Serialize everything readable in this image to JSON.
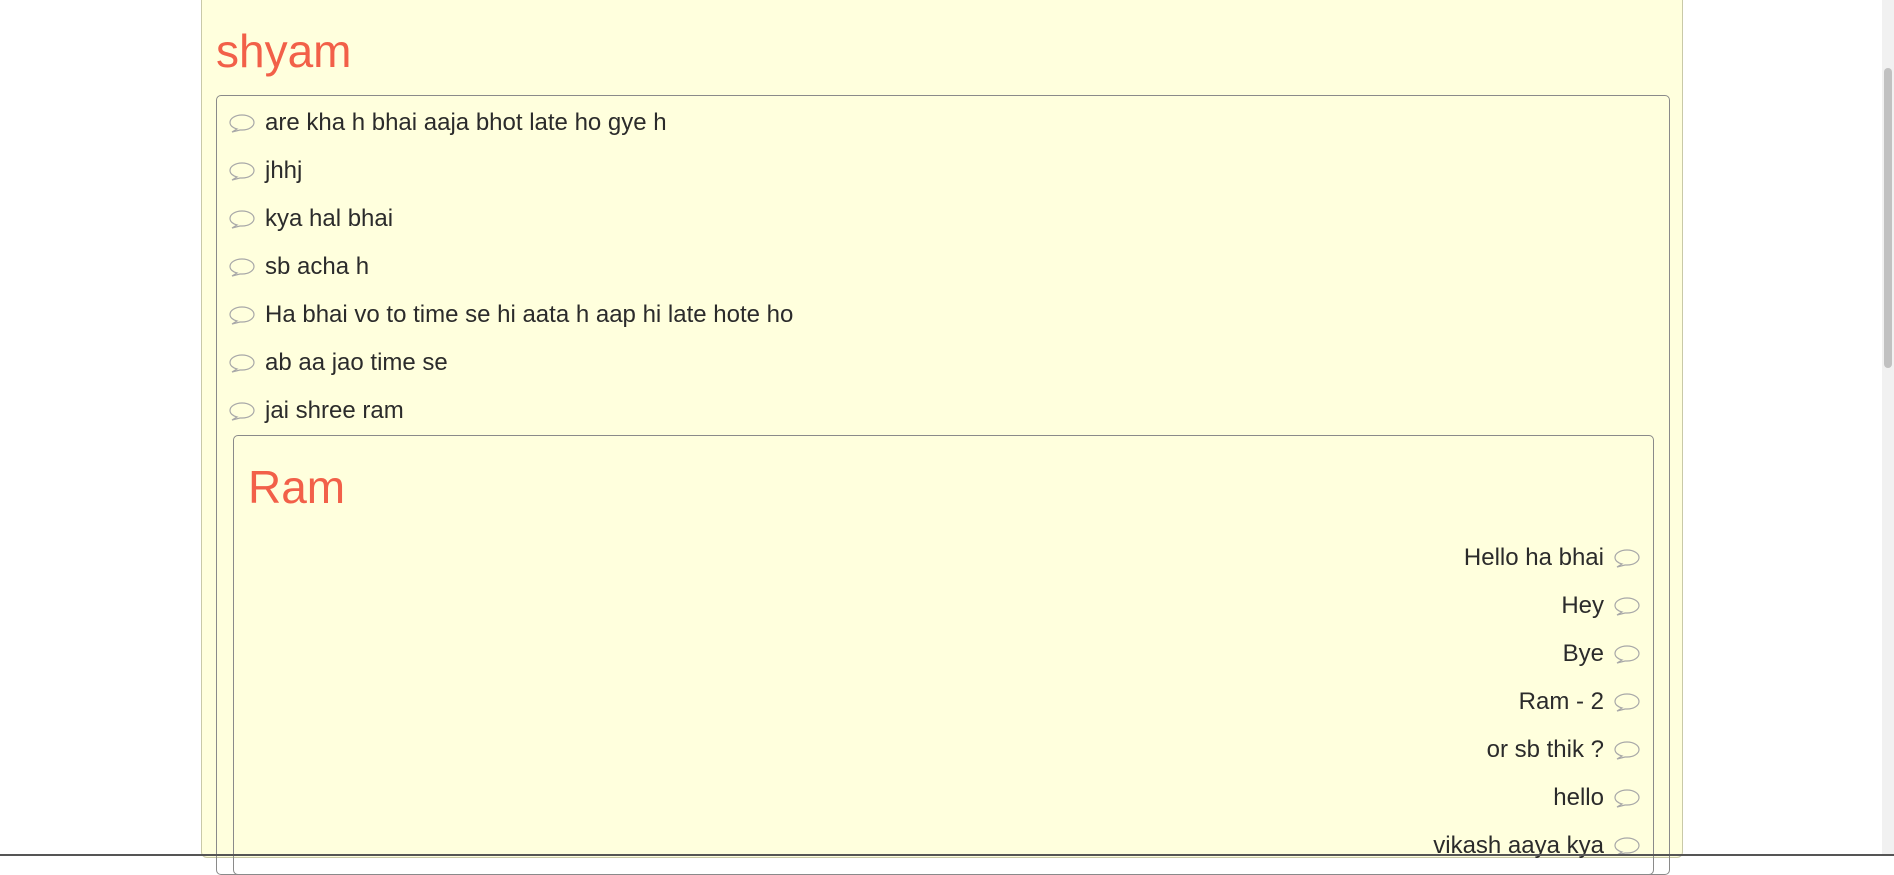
{
  "shyam": {
    "title": "shyam",
    "messages": [
      "are kha h bhai aaja bhot late ho gye h",
      "jhhj",
      "kya hal bhai",
      "sb acha h",
      "Ha bhai vo to time se hi aata h aap hi late hote ho",
      "ab aa jao time se",
      "jai shree ram"
    ]
  },
  "ram": {
    "title": "Ram",
    "messages": [
      "Hello ha bhai",
      "Hey",
      "Bye",
      "Ram - 2",
      "or sb thik ?",
      "hello",
      "vikash aaya kya"
    ]
  },
  "icons": {
    "message": "speech-bubble-icon"
  },
  "colors": {
    "title": "#f26049",
    "card_background": "#ffffdd",
    "text": "#2b2b2b"
  }
}
